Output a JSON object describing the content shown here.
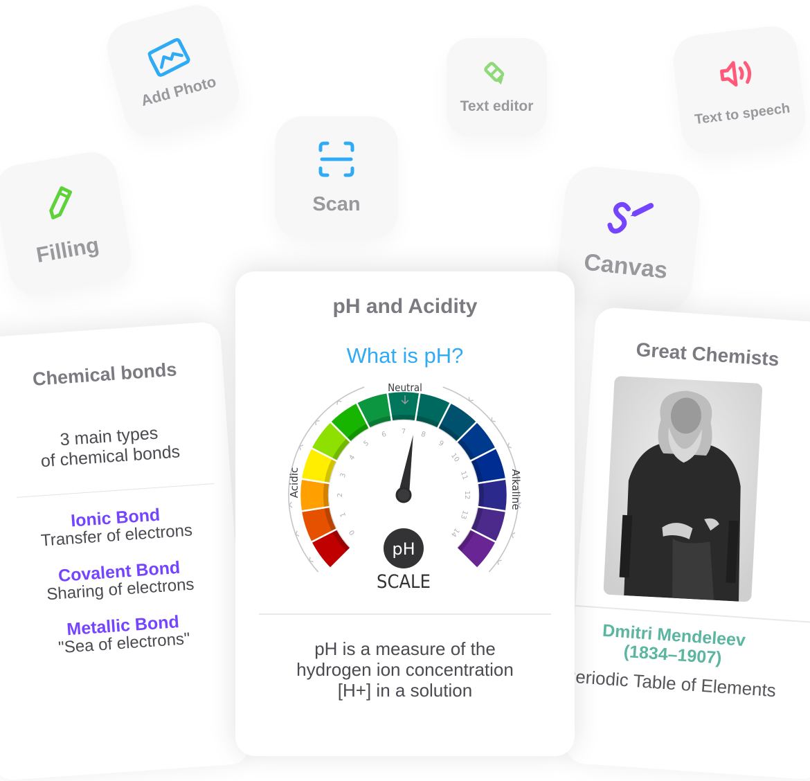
{
  "tiles": {
    "add_photo": {
      "label": "Add Photo",
      "icon": "image-icon",
      "color": "#2fabf5"
    },
    "text_editor": {
      "label": "Text editor",
      "icon": "highlighter-icon",
      "color": "#8fd97a"
    },
    "text_to_speech": {
      "label": "Text to speech",
      "icon": "speaker-icon",
      "color": "#ff5a7a"
    },
    "scan": {
      "label": "Scan",
      "icon": "scan-icon",
      "color": "#2fabf5"
    },
    "filling": {
      "label": "Filling",
      "icon": "pencil-icon",
      "color": "#5fd13a"
    },
    "canvas": {
      "label": "Canvas",
      "icon": "draw-icon",
      "color": "#7444ff"
    }
  },
  "cards": {
    "bonds": {
      "title": "Chemical bonds",
      "subtitle_line1": "3 main types",
      "subtitle_line2": "of chemical bonds",
      "items": [
        {
          "name": "Ionic Bond",
          "desc": "Transfer of electrons"
        },
        {
          "name": "Covalent Bond",
          "desc": "Sharing of electrons"
        },
        {
          "name": "Metallic Bond",
          "desc": "\"Sea of electrons\""
        }
      ]
    },
    "ph": {
      "title": "pH and Acidity",
      "question": "What is pH?",
      "gauge": {
        "neutral_label": "Neutral",
        "acidic_label": "Acidic",
        "alkaline_label": "Alkaline",
        "badge": "pH",
        "scale_label": "SCALE",
        "ticks": [
          "0",
          "1",
          "2",
          "3",
          "4",
          "5",
          "6",
          "7",
          "8",
          "9",
          "10",
          "11",
          "12",
          "13",
          "14"
        ],
        "needle_value": 7.5,
        "segment_colors": [
          "#c00000",
          "#e65100",
          "#ff9f00",
          "#ffee00",
          "#8ee000",
          "#17b500",
          "#0d9640",
          "#00765c",
          "#00695f",
          "#00516e",
          "#003a8c",
          "#002d91",
          "#2b2a8c",
          "#4b2a8c",
          "#6a2595"
        ]
      },
      "explain_line1": "pH is a measure of the",
      "explain_line2": "hydrogen ion concentration",
      "explain_line3": "[H+] in a solution"
    },
    "chemists": {
      "title": "Great Chemists",
      "portrait_alt": "Portrait of Dmitri Mendeleev",
      "name": "Dmitri Mendeleev",
      "years": "(1834–1907)",
      "fact": "Periodic Table of Elements"
    }
  }
}
